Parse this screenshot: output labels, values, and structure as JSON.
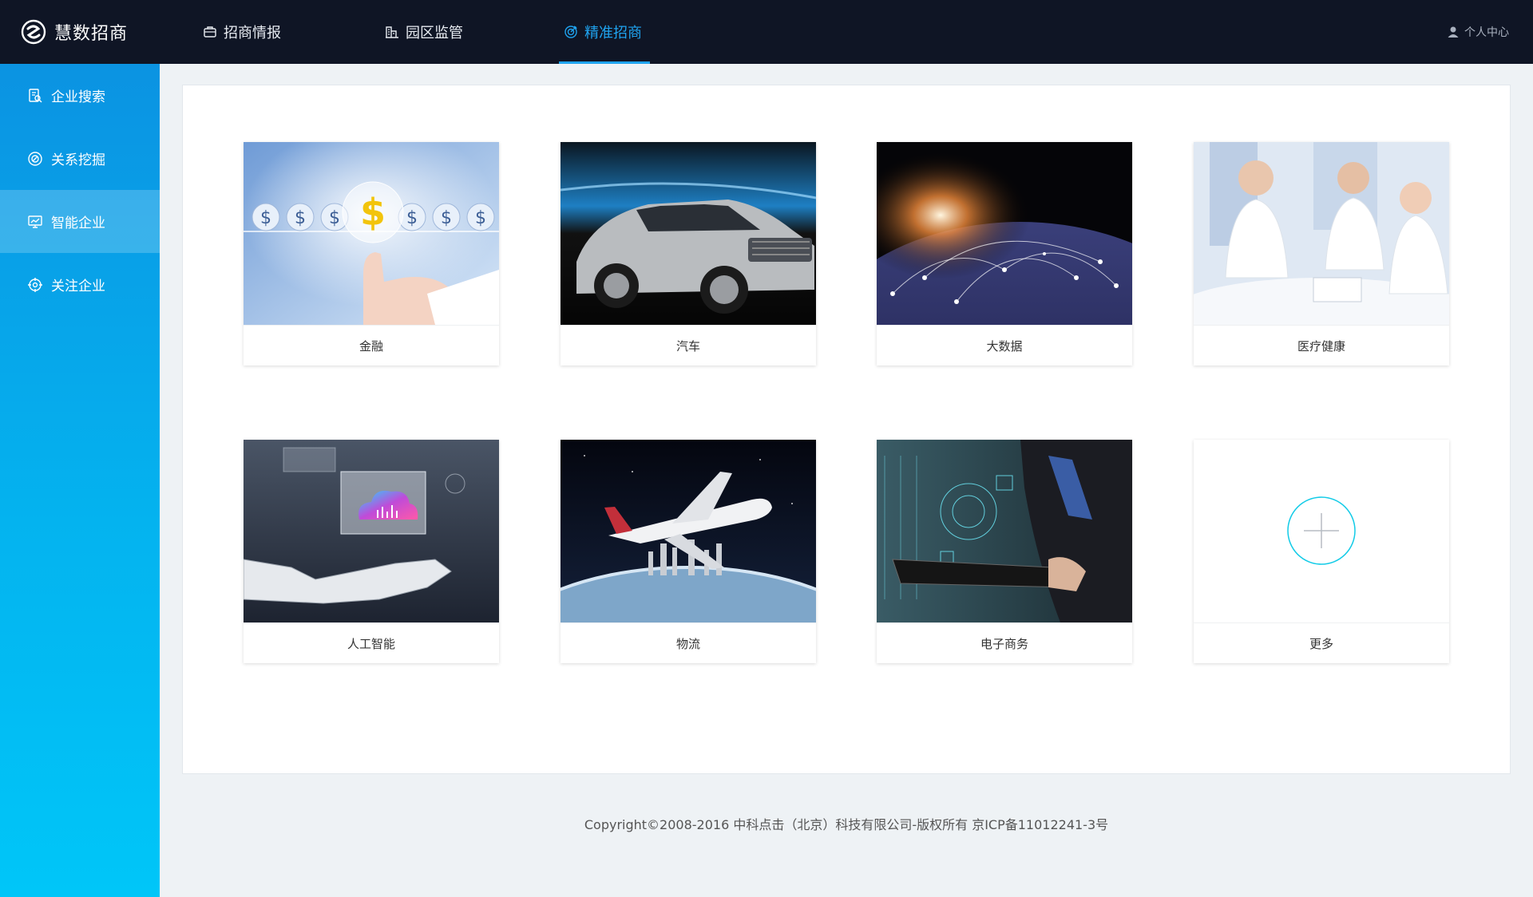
{
  "app": {
    "name": "慧数招商"
  },
  "nav": {
    "items": [
      {
        "label": "招商情报",
        "icon": "briefcase-icon"
      },
      {
        "label": "园区监管",
        "icon": "buildings-icon"
      },
      {
        "label": "精准招商",
        "icon": "target-icon",
        "active": true
      }
    ],
    "user_label": "个人中心"
  },
  "sidebar": {
    "items": [
      {
        "label": "企业搜索",
        "icon": "document-search-icon"
      },
      {
        "label": "关系挖掘",
        "icon": "relation-icon"
      },
      {
        "label": "智能企业",
        "icon": "chart-monitor-icon",
        "active": true
      },
      {
        "label": "关注企业",
        "icon": "crosshair-icon"
      }
    ]
  },
  "categories": [
    {
      "label": "金融",
      "image": "finance-dollar-image"
    },
    {
      "label": "汽车",
      "image": "car-image"
    },
    {
      "label": "大数据",
      "image": "earth-network-image"
    },
    {
      "label": "医疗健康",
      "image": "doctors-image"
    },
    {
      "label": "人工智能",
      "image": "robot-hand-cloud-image"
    },
    {
      "label": "物流",
      "image": "airplane-earth-image"
    },
    {
      "label": "电子商务",
      "image": "business-tablet-image"
    },
    {
      "label": "更多",
      "image": "plus-icon"
    }
  ],
  "footer": {
    "text": "Copyright©2008-2016 中科点击（北京）科技有限公司-版权所有  京ICP备11012241-3号"
  },
  "colors": {
    "accent": "#1fa3ef",
    "topbar": "#0f1525",
    "sidebar_top": "#0b93e2",
    "sidebar_bottom": "#00c6f8"
  }
}
